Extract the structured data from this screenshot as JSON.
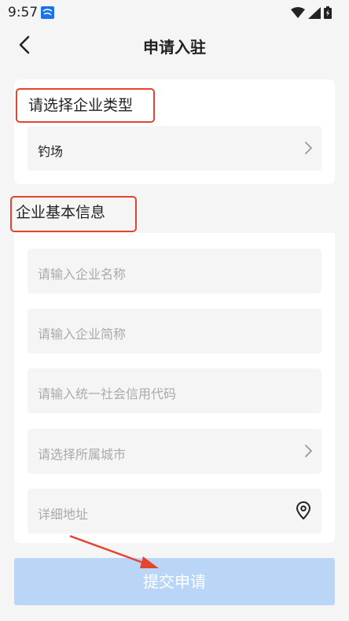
{
  "status_bar": {
    "time": "9:57"
  },
  "nav": {
    "title": "申请入驻"
  },
  "enterprise_type": {
    "section_title": "请选择企业类型",
    "selected_value": "钓场"
  },
  "basic_info": {
    "section_title": "企业基本信息",
    "fields": [
      {
        "placeholder": "请输入企业名称"
      },
      {
        "placeholder": "请输入企业简称"
      },
      {
        "placeholder": "请输入统一社会信用代码"
      },
      {
        "placeholder": "请选择所属城市"
      },
      {
        "placeholder": "详细地址"
      }
    ]
  },
  "submit": {
    "label": "提交申请"
  },
  "colors": {
    "annotation_red": "#e2442f",
    "submit_disabled": "#bad6f6",
    "background": "#f5f5f5"
  }
}
